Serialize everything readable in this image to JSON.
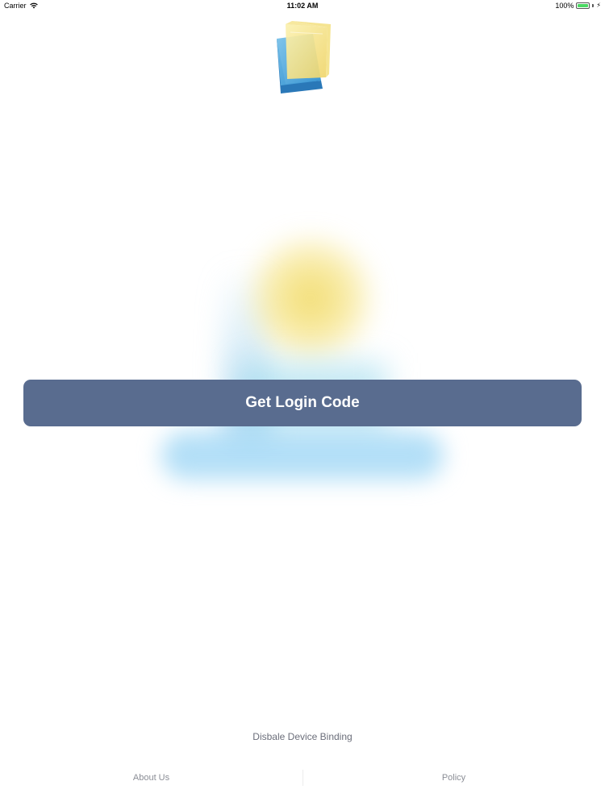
{
  "status_bar": {
    "carrier": "Carrier",
    "time": "11:02 AM",
    "battery": "100%",
    "battery_color": "#4cd964"
  },
  "logo": {
    "icon": "document-stack-logo"
  },
  "main": {
    "login_button_label": "Get Login Code",
    "button_color": "#596c8f"
  },
  "footer": {
    "disable_binding_label": "Disbale Device Binding",
    "about_label": "About Us",
    "policy_label": "Policy"
  }
}
